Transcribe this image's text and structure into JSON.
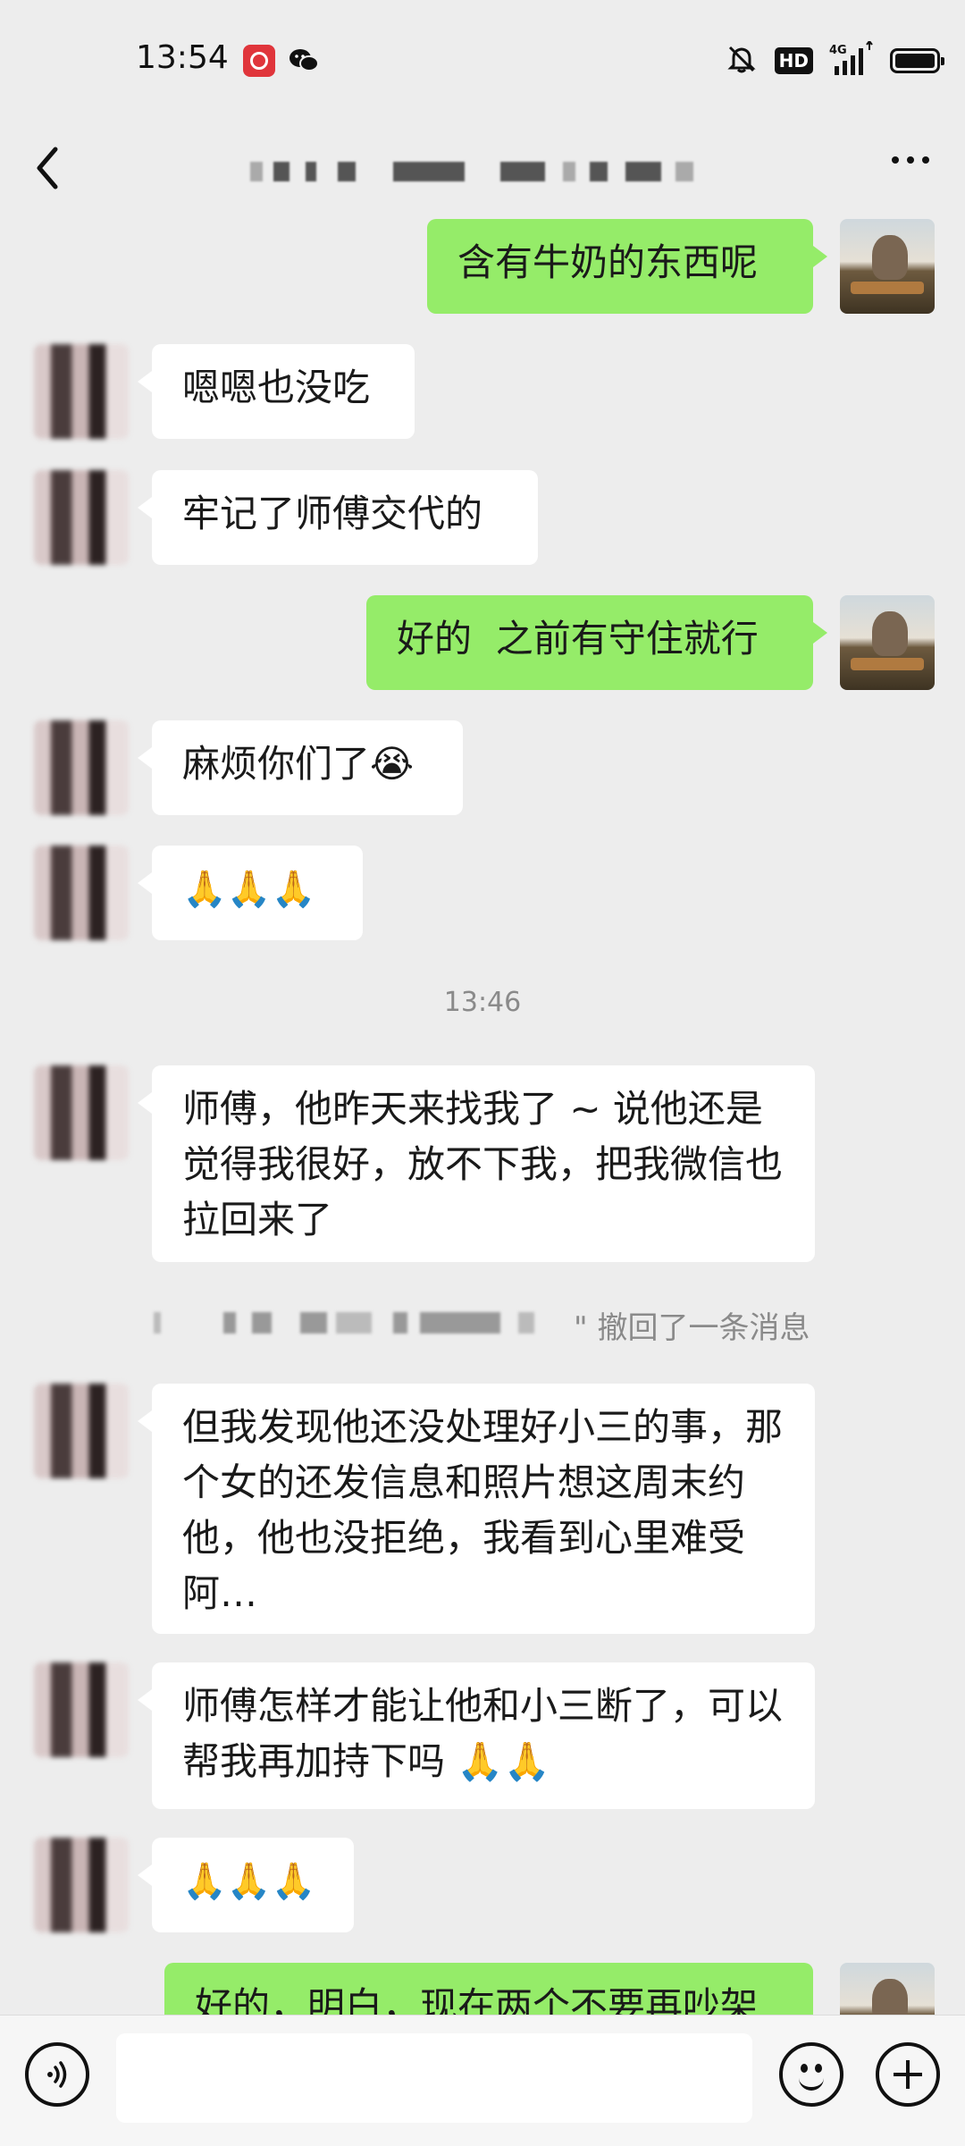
{
  "status_bar": {
    "time": "13:54",
    "network": "4G",
    "hd": "HD"
  },
  "chat": {
    "title_hidden": true
  },
  "messages": [
    {
      "from": "self",
      "text": "含有牛奶的东西呢"
    },
    {
      "from": "other",
      "text": "嗯嗯也没吃"
    },
    {
      "from": "other",
      "text": "牢记了师傅交代的"
    },
    {
      "from": "self",
      "text": "好的  之前有守住就行"
    },
    {
      "from": "other",
      "text": "麻烦你们了😭"
    },
    {
      "from": "other",
      "text": "🙏🙏🙏"
    },
    {
      "from": "other",
      "text": "师傅，他昨天来找我了 ~ 说他还是觉得我很好，放不下我，把我微信也拉回来了"
    },
    {
      "from": "other",
      "text": "但我发现他还没处理好小三的事，那个女的还发信息和照片想这周末约他，他也没拒绝，我看到心里难受阿…"
    },
    {
      "from": "other",
      "text": "师傅怎样才能让他和小三断了，可以帮我再加持下吗 🙏🙏"
    },
    {
      "from": "other",
      "text": "🙏🙏🙏"
    },
    {
      "from": "self",
      "text": "好的，明白，现在两个不要再吵架"
    }
  ],
  "timestamp": "13:46",
  "recall_text": "\" 撤回了一条消息",
  "input": {
    "placeholder": ""
  },
  "icons": [
    "back-icon",
    "more-icon",
    "voice-icon",
    "emoji-icon",
    "plus-icon"
  ]
}
